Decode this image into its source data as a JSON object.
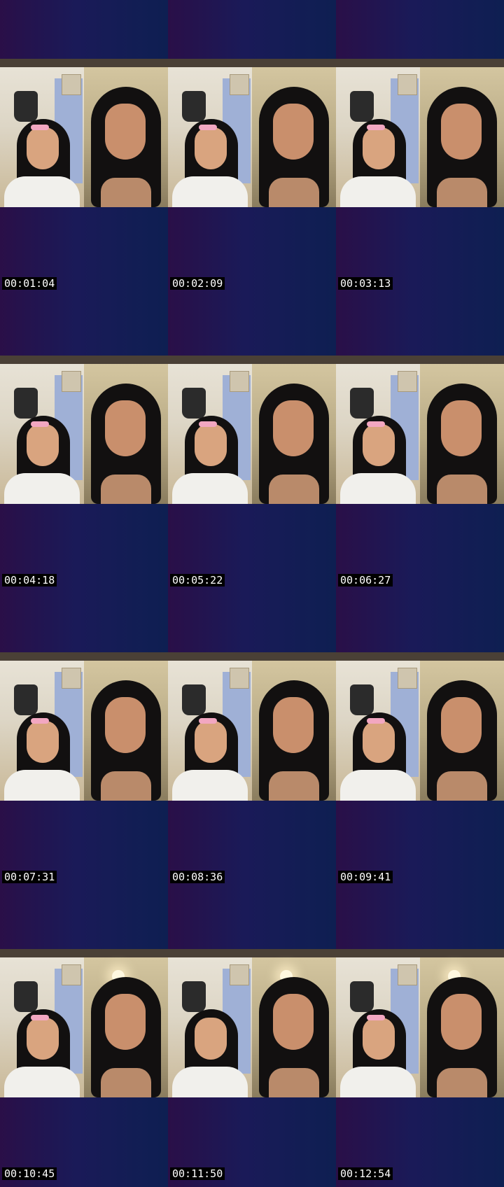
{
  "timestamps": [
    "00:01:04",
    "00:02:09",
    "00:03:13",
    "00:04:18",
    "00:05:22",
    "00:06:27",
    "00:07:31",
    "00:08:36",
    "00:09:41",
    "00:10:45",
    "00:11:50",
    "00:12:54"
  ]
}
